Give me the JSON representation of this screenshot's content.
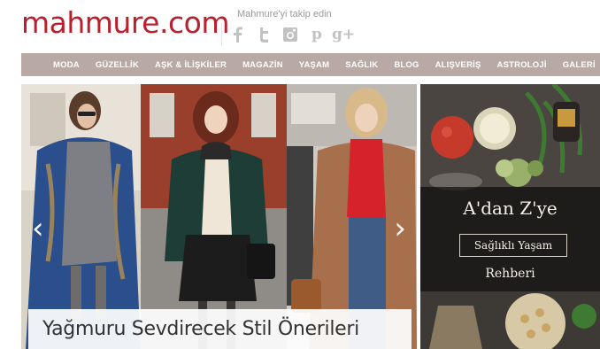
{
  "header": {
    "logo": "mahmure.com",
    "follow_text": "Mahmure'yi takip edin",
    "social_icons": [
      "facebook-icon",
      "twitter-icon",
      "instagram-icon",
      "pinterest-icon",
      "google-plus-icon"
    ],
    "pinterest_glyph": "p",
    "google_glyph": "g+"
  },
  "nav": {
    "items": [
      "MODA",
      "GÜZELLİK",
      "AŞK & İLİŞKİLER",
      "MAGAZİN",
      "YAŞAM",
      "SAĞLIK",
      "BLOG",
      "ALIŞVERİŞ",
      "ASTROLOJİ",
      "GALERİ"
    ]
  },
  "hero": {
    "caption": "Yağmuru Sevdirecek Stil Önerileri",
    "prev_arrow": "‹",
    "next_arrow": "›"
  },
  "ad": {
    "title": "A'dan Z'ye",
    "box_text": "Sağlıklı Yaşam",
    "subtitle": "Rehberi"
  },
  "colors": {
    "brand": "#b7202c",
    "nav_bg": "#b9a9a5"
  }
}
